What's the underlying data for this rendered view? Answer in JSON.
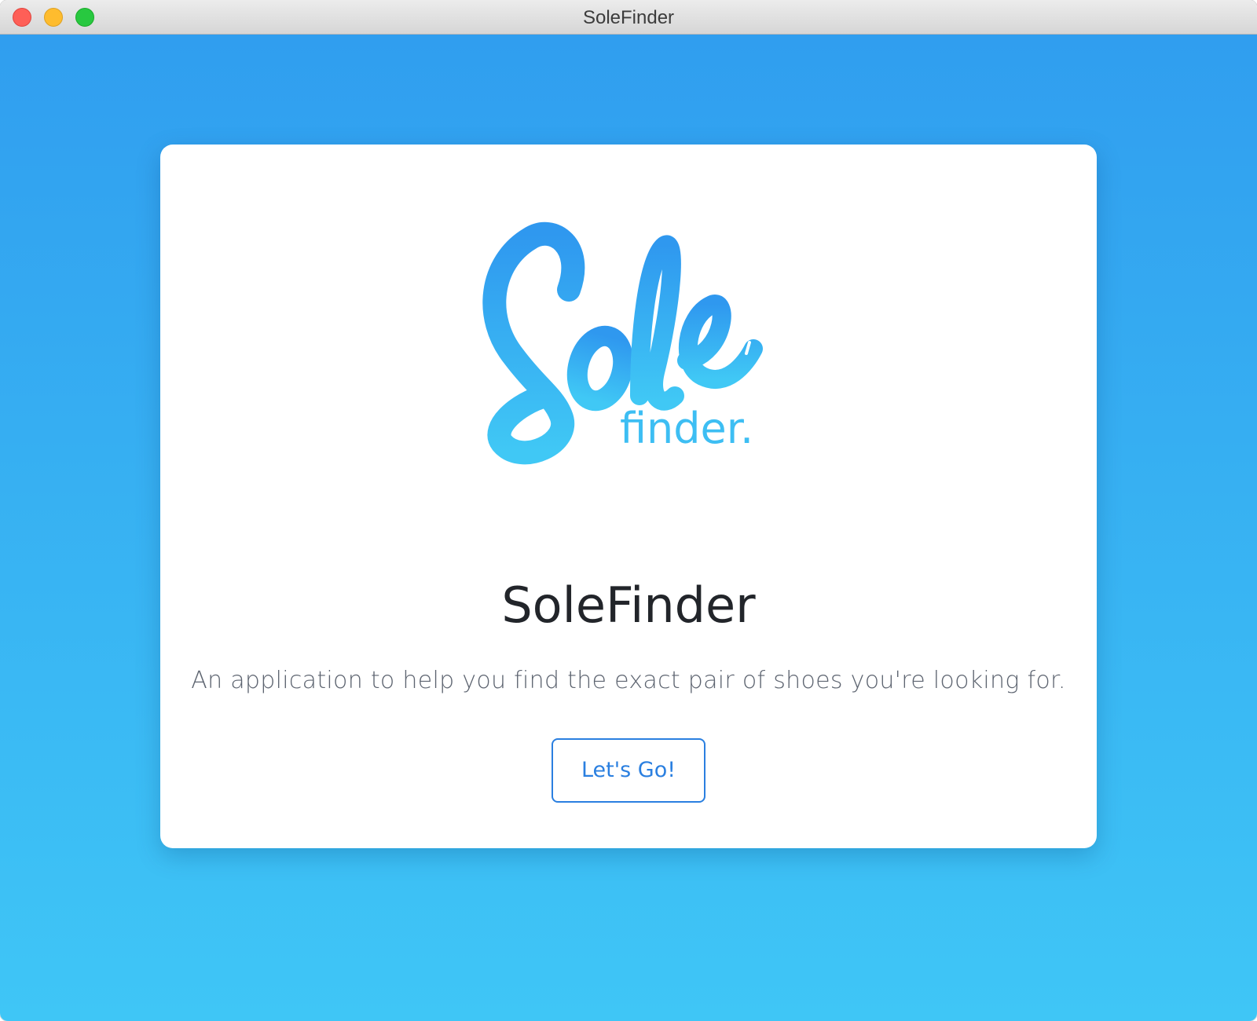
{
  "window": {
    "title": "SoleFinder"
  },
  "logo": {
    "script_text": "Sole",
    "sub_text": "finder.",
    "colors": [
      "#2f98ef",
      "#40c8f5"
    ]
  },
  "hero": {
    "title": "SoleFinder",
    "tagline": "An application to help you find the exact pair of shoes you're looking for.",
    "cta_label": "Let's Go!"
  },
  "theme": {
    "background_top": "#309eef",
    "background_bottom": "#3fc6f6",
    "accent": "#2a7fe0"
  }
}
